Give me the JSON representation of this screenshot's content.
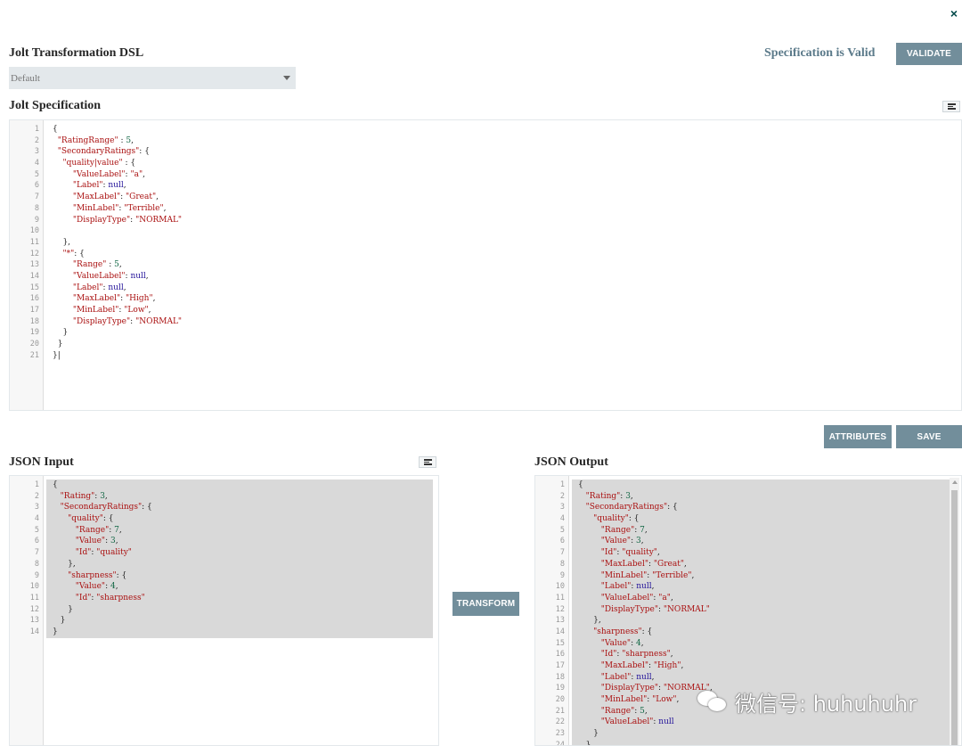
{
  "dialog": {
    "close_label": "×"
  },
  "dsl": {
    "title": "Jolt Transformation DSL",
    "selected": "Default",
    "status": "Specification is Valid",
    "validate_label": "VALIDATE"
  },
  "spec": {
    "title": "Jolt Specification",
    "format_icon": "format-icon",
    "lines": [
      "{",
      "  \"RatingRange\" : 5,",
      "  \"SecondaryRatings\": {",
      "    \"quality|value\" : {",
      "        \"ValueLabel\": \"a\",",
      "        \"Label\": null,",
      "        \"MaxLabel\": \"Great\",",
      "        \"MinLabel\": \"Terrible\",",
      "        \"DisplayType\": \"NORMAL\"",
      "",
      "    },",
      "    \"*\": {",
      "        \"Range\" : 5,",
      "        \"ValueLabel\": null,",
      "        \"Label\": null,",
      "        \"MaxLabel\": \"High\",",
      "        \"MinLabel\": \"Low\",",
      "        \"DisplayType\": \"NORMAL\"",
      "    }",
      "  }",
      "}|"
    ]
  },
  "actions": {
    "attributes_label": "ATTRIBUTES",
    "save_label": "SAVE",
    "transform_label": "TRANSFORM"
  },
  "input": {
    "title": "JSON Input",
    "format_icon": "format-icon",
    "lines": [
      "{",
      "   \"Rating\": 3,",
      "   \"SecondaryRatings\": {",
      "      \"quality\": {",
      "         \"Range\": 7,",
      "         \"Value\": 3,",
      "         \"Id\": \"quality\"",
      "      },",
      "      \"sharpness\": {",
      "         \"Value\": 4,",
      "         \"Id\": \"sharpness\"",
      "      }",
      "   }",
      "}"
    ]
  },
  "output": {
    "title": "JSON Output",
    "lines": [
      "{",
      "   \"Rating\": 3,",
      "   \"SecondaryRatings\": {",
      "      \"quality\": {",
      "         \"Range\": 7,",
      "         \"Value\": 3,",
      "         \"Id\": \"quality\",",
      "         \"MaxLabel\": \"Great\",",
      "         \"MinLabel\": \"Terrible\",",
      "         \"Label\": null,",
      "         \"ValueLabel\": \"a\",",
      "         \"DisplayType\": \"NORMAL\"",
      "      },",
      "      \"sharpness\": {",
      "         \"Value\": 4,",
      "         \"Id\": \"sharpness\",",
      "         \"MaxLabel\": \"High\",",
      "         \"Label\": null,",
      "         \"DisplayType\": \"NORMAL\",",
      "         \"MinLabel\": \"Low\",",
      "         \"Range\": 5,",
      "         \"ValueLabel\": null",
      "      }",
      "   }"
    ]
  },
  "watermark": {
    "text": "微信号: huhuhuhr",
    "icon": "wechat-icon"
  }
}
